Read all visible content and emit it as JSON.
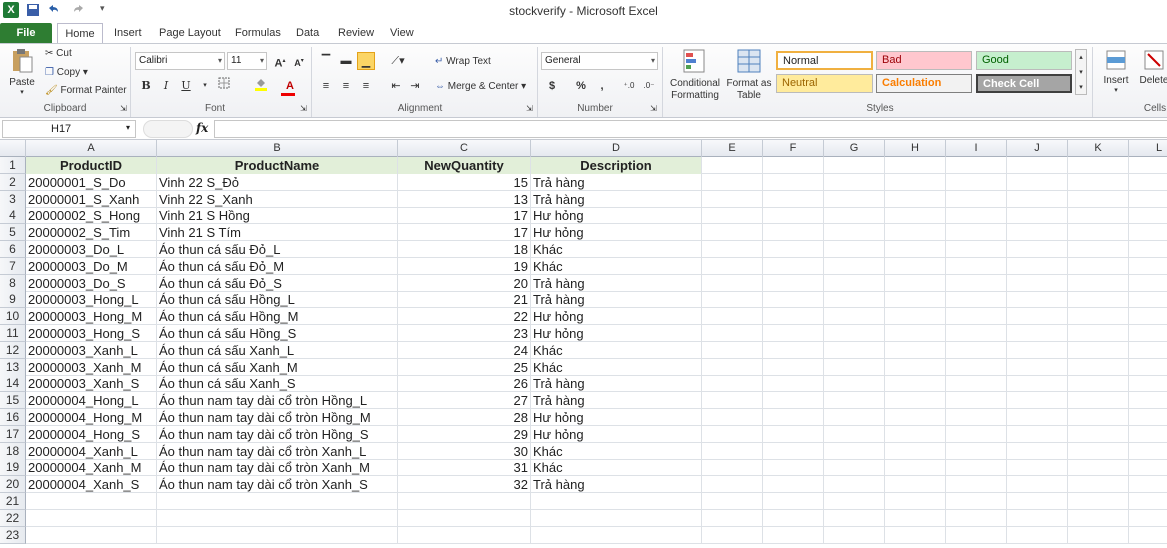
{
  "window": {
    "title": "stockverify  -  Microsoft Excel",
    "app_icon": "X"
  },
  "tabs": [
    "File",
    "Home",
    "Insert",
    "Page Layout",
    "Formulas",
    "Data",
    "Review",
    "View"
  ],
  "ribbon": {
    "clipboard": {
      "paste": "Paste",
      "cut": "Cut",
      "copy": "Copy",
      "format_painter": "Format Painter",
      "label": "Clipboard"
    },
    "font": {
      "name": "Calibri",
      "size": "11",
      "label": "Font",
      "bold": "B",
      "italic": "I",
      "underline": "U"
    },
    "alignment": {
      "wrap": "Wrap Text",
      "merge": "Merge & Center",
      "label": "Alignment"
    },
    "number": {
      "format": "General",
      "currency": "$",
      "percent": "%",
      "comma": ",",
      "label": "Number"
    },
    "styles": {
      "conditional": "Conditional Formatting",
      "format_table": "Format as Table",
      "normal": "Normal",
      "bad": "Bad",
      "good": "Good",
      "neutral": "Neutral",
      "calculation": "Calculation",
      "check_cell": "Check Cell",
      "label": "Styles"
    },
    "cells": {
      "insert": "Insert",
      "delete": "Delete",
      "label": "Cells"
    }
  },
  "formula_bar": {
    "name_box": "H17",
    "fx": "fx",
    "value": ""
  },
  "columns": [
    "A",
    "B",
    "C",
    "D",
    "E",
    "F",
    "G",
    "H",
    "I",
    "J",
    "K",
    "L"
  ],
  "row_numbers": [
    "1",
    "2",
    "3",
    "4",
    "5",
    "6",
    "7",
    "8",
    "9",
    "10",
    "11",
    "12",
    "13",
    "14",
    "15",
    "16",
    "17",
    "18",
    "19",
    "20",
    "21",
    "22",
    "23"
  ],
  "headers": [
    "ProductID",
    "ProductName",
    "NewQuantity",
    "Description"
  ],
  "rows": [
    [
      "20000001_S_Do",
      "Vinh 22 S_Đỏ",
      "15",
      "Trả hàng"
    ],
    [
      "20000001_S_Xanh",
      "Vinh 22 S_Xanh",
      "13",
      "Trả hàng"
    ],
    [
      "20000002_S_Hong",
      "Vinh 21 S Hồng",
      "17",
      "Hư hỏng"
    ],
    [
      "20000002_S_Tim",
      "Vinh 21 S Tím",
      "17",
      "Hư hỏng"
    ],
    [
      "20000003_Do_L",
      "Áo thun cá sấu Đỏ_L",
      "18",
      "Khác"
    ],
    [
      "20000003_Do_M",
      "Áo thun cá sấu Đỏ_M",
      "19",
      "Khác"
    ],
    [
      "20000003_Do_S",
      "Áo thun cá sấu Đỏ_S",
      "20",
      "Trả hàng"
    ],
    [
      "20000003_Hong_L",
      "Áo thun cá sấu Hồng_L",
      "21",
      "Trả hàng"
    ],
    [
      "20000003_Hong_M",
      "Áo thun cá sấu Hồng_M",
      "22",
      "Hư hỏng"
    ],
    [
      "20000003_Hong_S",
      "Áo thun cá sấu Hồng_S",
      "23",
      "Hư hỏng"
    ],
    [
      "20000003_Xanh_L",
      "Áo thun cá sấu Xanh_L",
      "24",
      "Khác"
    ],
    [
      "20000003_Xanh_M",
      "Áo thun cá sấu Xanh_M",
      "25",
      "Khác"
    ],
    [
      "20000003_Xanh_S",
      "Áo thun cá sấu Xanh_S",
      "26",
      "Trả hàng"
    ],
    [
      "20000004_Hong_L",
      "Áo thun nam tay dài cổ tròn Hồng_L",
      "27",
      "Trả hàng"
    ],
    [
      "20000004_Hong_M",
      "Áo thun nam tay dài cổ tròn Hồng_M",
      "28",
      "Hư hỏng"
    ],
    [
      "20000004_Hong_S",
      "Áo thun nam tay dài cổ tròn Hồng_S",
      "29",
      "Hư hỏng"
    ],
    [
      "20000004_Xanh_L",
      "Áo thun nam tay dài cổ tròn Xanh_L",
      "30",
      "Khác"
    ],
    [
      "20000004_Xanh_M",
      "Áo thun nam tay dài cổ tròn Xanh_M",
      "31",
      "Khác"
    ],
    [
      "20000004_Xanh_S",
      "Áo thun nam tay dài cổ tròn Xanh_S",
      "32",
      "Trả hàng"
    ]
  ],
  "colors": {
    "file_tab": "#2e7d32",
    "header_fill": "#e2efd9",
    "bad_fill": "#ffc7ce",
    "good_fill": "#c6efce",
    "neutral_fill": "#ffeb9c"
  }
}
